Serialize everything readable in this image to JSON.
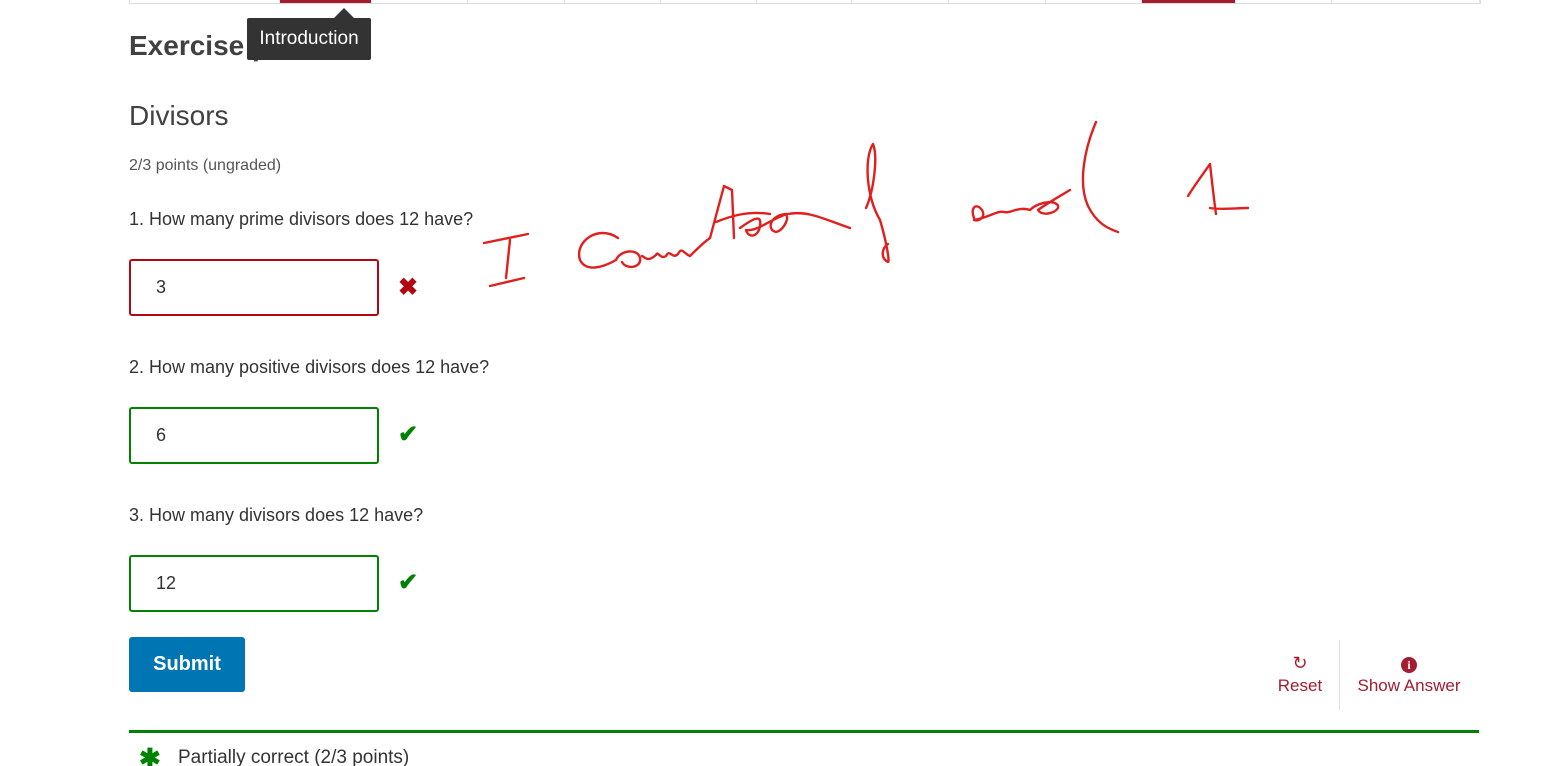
{
  "seq_nav": {
    "tabs": [
      {
        "active": false
      },
      {
        "active": true
      },
      {
        "active": false
      },
      {
        "active": false
      },
      {
        "active": false
      },
      {
        "active": false
      },
      {
        "active": false
      },
      {
        "active": false
      },
      {
        "active": false
      },
      {
        "active": false
      },
      {
        "active": false
      },
      {
        "active": true
      },
      {
        "active": false
      },
      {
        "active": false
      }
    ]
  },
  "tooltip": {
    "text": "Introduction"
  },
  "unit": {
    "title": "Exercise |"
  },
  "problem": {
    "title": "Divisors",
    "points": "2/3 points (ungraded)",
    "questions": [
      {
        "prompt": "1. How many prime divisors does 12 have?",
        "answer": "3",
        "status": "incorrect",
        "icon": "cross-icon"
      },
      {
        "prompt": "2. How many positive divisors does 12 have?",
        "answer": "6",
        "status": "correct",
        "icon": "check-icon"
      },
      {
        "prompt": "3. How many divisors does 12 have?",
        "answer": "12",
        "status": "correct",
        "icon": "check-icon"
      }
    ]
  },
  "actions": {
    "submit_label": "Submit",
    "reset_label": "Reset",
    "show_answer_label": "Show Answer"
  },
  "notification": {
    "text": "Partially correct (2/3 points)",
    "icon": "asterisk-icon"
  },
  "colors": {
    "accent": "#a51c30",
    "correct": "#008100",
    "incorrect": "#b20610",
    "primary_button": "#0075b4",
    "annotation": "#e0201e"
  },
  "annotation": {
    "handwritten_text": "I counted and 1"
  }
}
